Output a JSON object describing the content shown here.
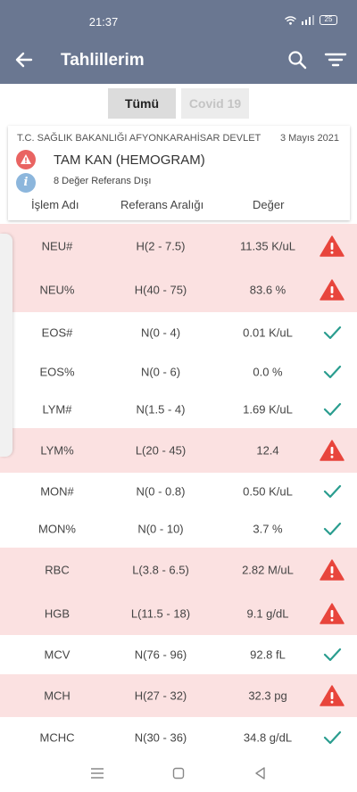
{
  "status": {
    "time": "21:37",
    "battery": "25"
  },
  "app": {
    "title": "Tahlillerim"
  },
  "tabs": [
    {
      "label": "Tümü",
      "selected": true
    },
    {
      "label": "Covid 19",
      "selected": false
    }
  ],
  "card": {
    "hospital": "T.C. SAĞLIK BAKANLIĞI AFYONKARAHİSAR DEVLET",
    "date": "3 Mayıs 2021",
    "test_name": "TAM KAN (HEMOGRAM)",
    "out_of_range": "8 Değer Referans Dışı",
    "info_glyph": "i",
    "columns": {
      "name": "İşlem Adı",
      "ref": "Referans Aralığı",
      "value": "Değer"
    }
  },
  "colors": {
    "header": "#6a7791",
    "abnormal_row": "#fbe1e1",
    "warning": "#e8453c",
    "ok": "#2a9d8f"
  },
  "rows": [
    {
      "name": "NEU#",
      "ref": "H(2 - 7.5)",
      "value": "11.35 K/uL",
      "status": "abnormal"
    },
    {
      "name": "NEU%",
      "ref": "H(40 - 75)",
      "value": "83.6 %",
      "status": "abnormal"
    },
    {
      "name": "EOS#",
      "ref": "N(0 - 4)",
      "value": "0.01 K/uL",
      "status": "normal"
    },
    {
      "name": "EOS%",
      "ref": "N(0 - 6)",
      "value": "0.0 %",
      "status": "normal"
    },
    {
      "name": "LYM#",
      "ref": "N(1.5 - 4)",
      "value": "1.69 K/uL",
      "status": "normal"
    },
    {
      "name": "LYM%",
      "ref": "L(20 - 45)",
      "value": "12.4",
      "status": "abnormal"
    },
    {
      "name": "MON#",
      "ref": "N(0 - 0.8)",
      "value": "0.50 K/uL",
      "status": "normal"
    },
    {
      "name": "MON%",
      "ref": "N(0 - 10)",
      "value": "3.7 %",
      "status": "normal"
    },
    {
      "name": "RBC",
      "ref": "L(3.8 - 6.5)",
      "value": "2.82 M/uL",
      "status": "abnormal"
    },
    {
      "name": "HGB",
      "ref": "L(11.5 - 18)",
      "value": "9.1 g/dL",
      "status": "abnormal"
    },
    {
      "name": "MCV",
      "ref": "N(76 - 96)",
      "value": "92.8 fL",
      "status": "normal"
    },
    {
      "name": "MCH",
      "ref": "H(27 - 32)",
      "value": "32.3 pg",
      "status": "abnormal"
    },
    {
      "name": "MCHC",
      "ref": "N(30 - 36)",
      "value": "34.8 g/dL",
      "status": "normal"
    }
  ]
}
